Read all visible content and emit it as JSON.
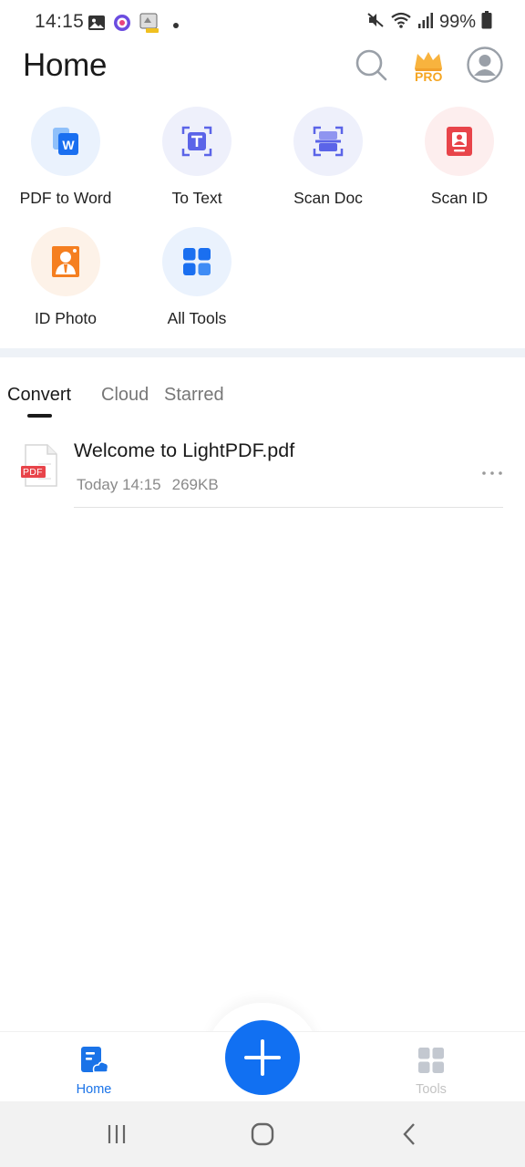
{
  "status_bar": {
    "time": "14:15",
    "battery": "99%",
    "icons_left": [
      "gallery-icon",
      "camera-app-icon",
      "notification-app-icon"
    ],
    "icons_right": [
      "mute-icon",
      "wifi-icon",
      "signal-icon",
      "battery-icon"
    ]
  },
  "header": {
    "title": "Home",
    "pro_label": "PRO"
  },
  "tools": [
    {
      "label": "PDF to Word",
      "icon": "pdf-to-word-icon",
      "color": "#1a6ff0",
      "bg": "#eaf2fd"
    },
    {
      "label": "To Text",
      "icon": "to-text-icon",
      "color": "#5b64e8",
      "bg": "#eef0fb"
    },
    {
      "label": "Scan Doc",
      "icon": "scan-doc-icon",
      "color": "#5b64e8",
      "bg": "#eef0fb"
    },
    {
      "label": "Scan ID",
      "icon": "scan-id-icon",
      "color": "#e8444a",
      "bg": "#fdeeee"
    },
    {
      "label": "ID Photo",
      "icon": "id-photo-icon",
      "color": "#f57f20",
      "bg": "#fdf2e8"
    },
    {
      "label": "All Tools",
      "icon": "all-tools-icon",
      "color": "#1a6ff0",
      "bg": "#eaf2fd"
    }
  ],
  "tabs": [
    {
      "label": "Convert",
      "active": true
    },
    {
      "label": "Cloud",
      "active": false
    },
    {
      "label": "Starred",
      "active": false
    }
  ],
  "files": [
    {
      "name": "Welcome to LightPDF.pdf",
      "date": "Today 14:15",
      "size": "269KB",
      "type_badge": "PDF"
    }
  ],
  "bottom_nav": {
    "home_label": "Home",
    "tools_label": "Tools"
  },
  "colors": {
    "accent": "#1170f2",
    "active_nav": "#1a73e8",
    "pro_gold": "#f5a623"
  }
}
